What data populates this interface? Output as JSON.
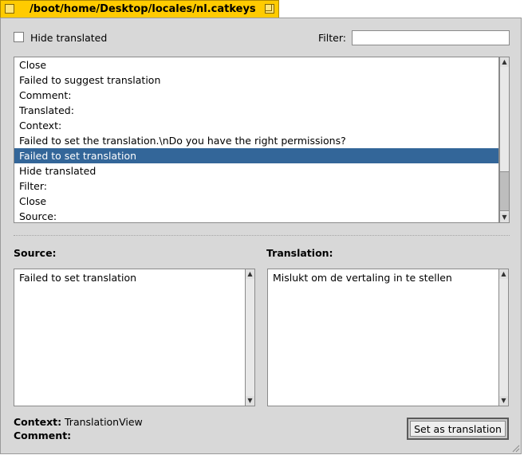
{
  "window": {
    "title": "/boot/home/Desktop/locales/nl.catkeys"
  },
  "controls": {
    "hide_translated_label": "Hide translated",
    "hide_translated_checked": false,
    "filter_label": "Filter:",
    "filter_value": ""
  },
  "list": {
    "items": [
      "Close",
      "Failed to suggest translation",
      "Comment:",
      "Translated:",
      "Context:",
      "Failed to set the translation.\\nDo you have the right permissions?",
      "Failed to set translation",
      "Hide translated",
      "Filter:",
      "Close",
      "Source:"
    ],
    "selected_index": 6
  },
  "source": {
    "label": "Source:",
    "text": "Failed to set translation"
  },
  "translation": {
    "label": "Translation:",
    "text": "Mislukt om de vertaling in te stellen"
  },
  "footer": {
    "context_label": "Context:",
    "context_value": "TranslationView",
    "comment_label": "Comment:",
    "comment_value": "",
    "set_button_label": "Set as translation"
  },
  "colors": {
    "tab": "#ffcb00",
    "selection": "#336699",
    "window_bg": "#d8d8d8"
  }
}
